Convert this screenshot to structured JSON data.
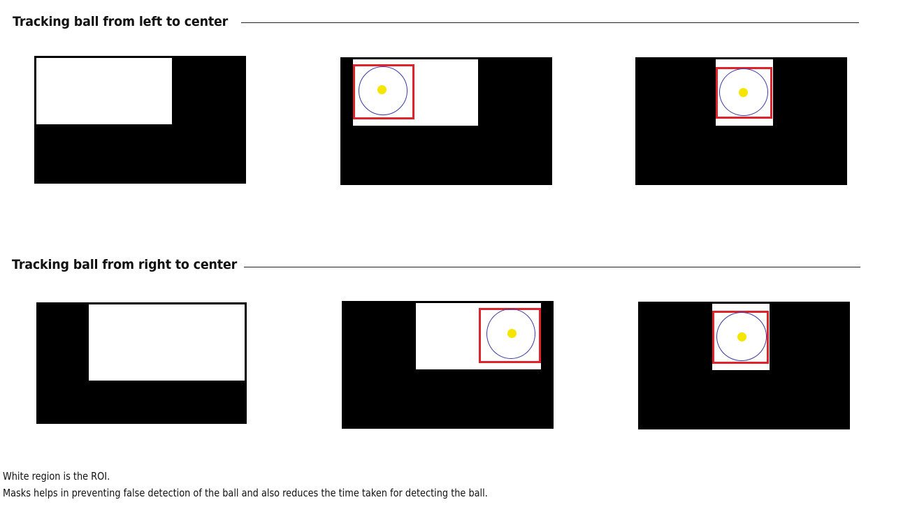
{
  "sections": [
    {
      "title": "Tracking ball from left to center"
    },
    {
      "title": "Tracking ball from right to center"
    }
  ],
  "colors": {
    "frame": "#000000",
    "roi": "#ffffff",
    "bbox": "#e0222a",
    "ring": "#3a3aa8",
    "ball": "#f5e600"
  },
  "notes": [
    "White region is the ROI.",
    "Masks helps in preventing false detection of the ball and also reduces the time taken for detecting the ball."
  ]
}
